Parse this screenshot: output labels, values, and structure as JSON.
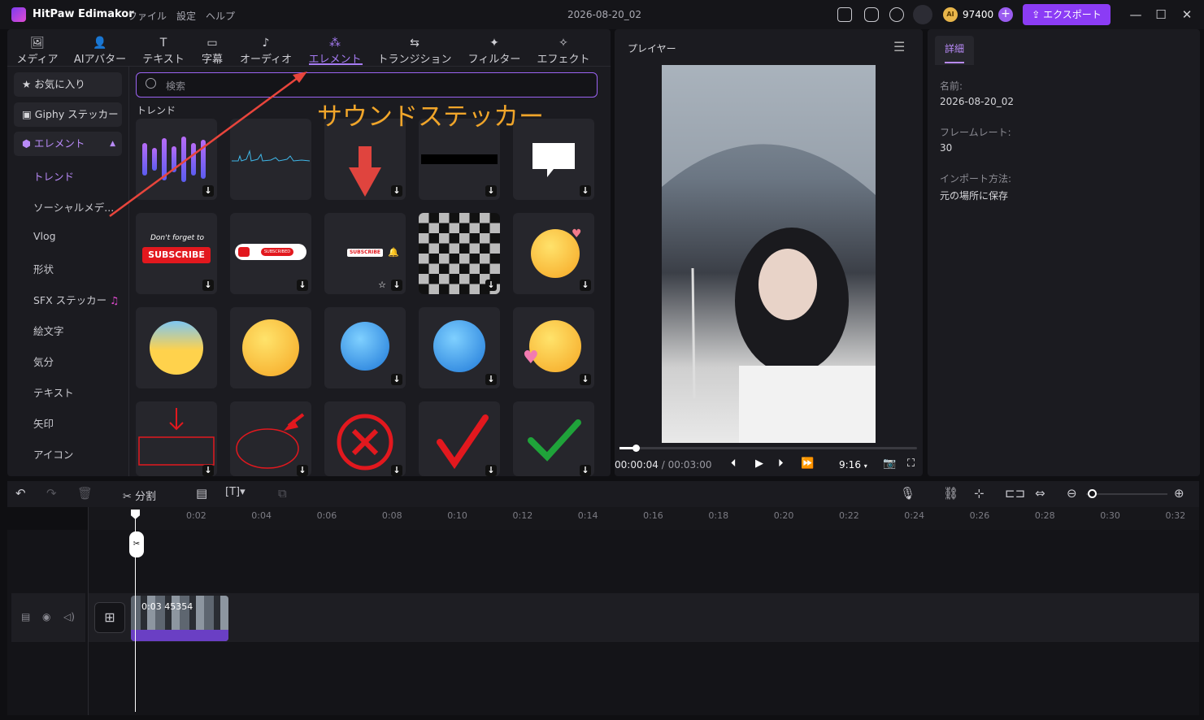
{
  "app": {
    "name": "HitPaw Edimakor",
    "project_title": "2026-08-20_02",
    "credits": "97400",
    "export_label": "エクスポート"
  },
  "menu": [
    "ファイル",
    "設定",
    "ヘルプ"
  ],
  "tabs": [
    "メディア",
    "AIアバター",
    "テキスト",
    "字幕",
    "オーディオ",
    "エレメント",
    "トランジション",
    "フィルター",
    "エフェクト"
  ],
  "sidebar": {
    "favorites": "お気に入り",
    "giphy": "Giphy ステッカー",
    "elements": "エレメント",
    "items": [
      "トレンド",
      "ソーシャルメデ...",
      "Vlog",
      "形状",
      "SFX ステッカー",
      "絵文字",
      "気分",
      "テキスト",
      "矢印",
      "アイコン"
    ]
  },
  "search": {
    "placeholder": "検索"
  },
  "section_label": "トレンド",
  "annotation": "サウンドステッカー",
  "stickers": {
    "dont_forget": "Don't forget to",
    "subscribe": "SUBSCRIBE",
    "subscribed": "SUBSCRIBED"
  },
  "player": {
    "title": "プレイヤー",
    "current": "00:00:04",
    "total": "/ 00:03:00",
    "ratio": "9:16",
    "progress": 0.02
  },
  "details": {
    "tab": "詳細",
    "name_label": "名前:",
    "name_value": "2026-08-20_02",
    "fps_label": "フレームレート:",
    "fps_value": "30",
    "import_label": "インポート方法:",
    "import_value": "元の場所に保存"
  },
  "timeline": {
    "split_label": "分割",
    "ticks": [
      "0:02",
      "0:04",
      "0:06",
      "0:08",
      "0:10",
      "0:12",
      "0:14",
      "0:16",
      "0:18",
      "0:20",
      "0:22",
      "0:24",
      "0:26",
      "0:28",
      "0:30",
      "0:32"
    ],
    "clip_label": "0:03 45354"
  },
  "colors": {
    "accent": "#8b3cf5",
    "annotation": "#f0a52a",
    "clip": "#6a3fc4"
  }
}
